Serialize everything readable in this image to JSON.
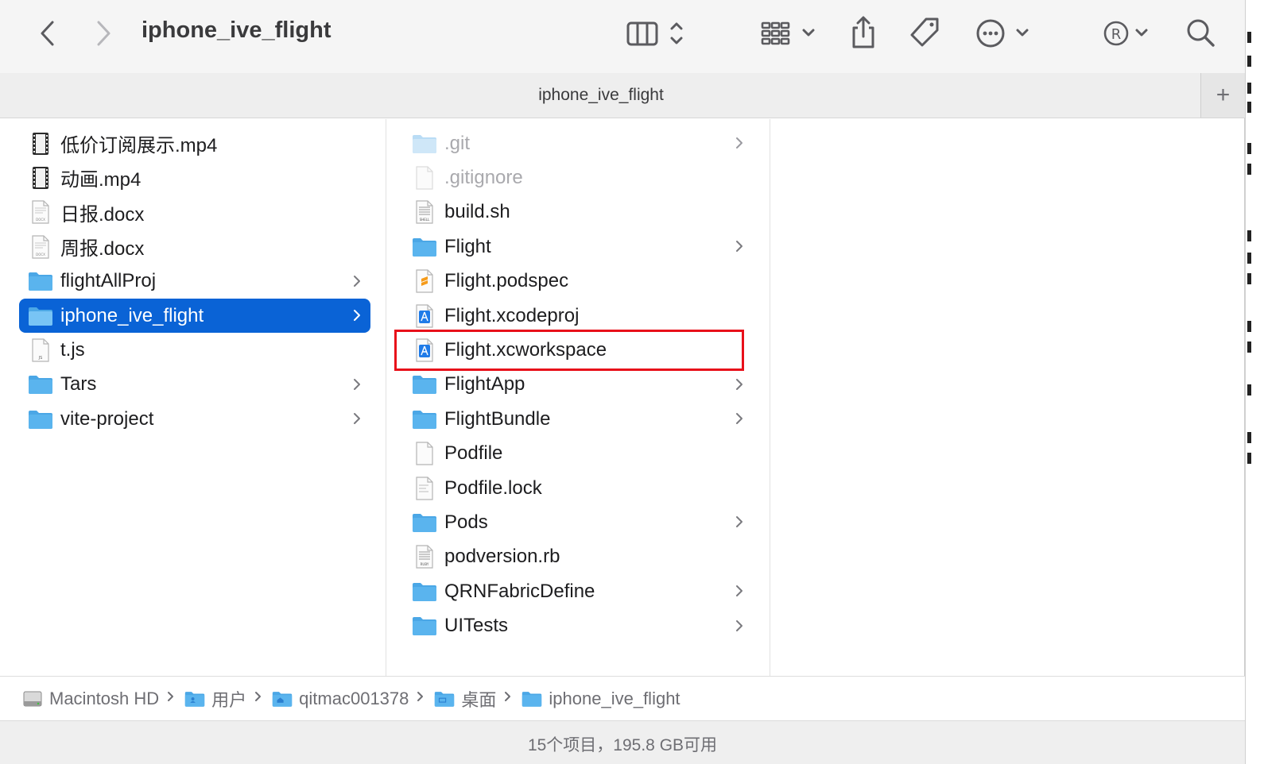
{
  "window": {
    "title": "iphone_ive_flight",
    "tab_title": "iphone_ive_flight"
  },
  "toolbar": {
    "back": "chevron-left-icon",
    "forward": "chevron-right-icon",
    "view_mode": "columns-view-icon",
    "group": "grid-group-icon",
    "share": "share-icon",
    "tag": "tag-icon",
    "more": "ellipsis-circle-icon",
    "extension": "registered-icon",
    "search": "search-icon"
  },
  "column1": {
    "items": [
      {
        "name": "低价订阅展示.mp4",
        "icon": "movie-file-icon",
        "folder": false
      },
      {
        "name": "动画.mp4",
        "icon": "movie-file-icon",
        "folder": false
      },
      {
        "name": "日报.docx",
        "icon": "docx-file-icon",
        "folder": false
      },
      {
        "name": "周报.docx",
        "icon": "docx-file-icon",
        "folder": false
      },
      {
        "name": "flightAllProj",
        "icon": "folder-icon",
        "folder": true
      },
      {
        "name": "iphone_ive_flight",
        "icon": "folder-icon",
        "folder": true,
        "selected": true
      },
      {
        "name": "t.js",
        "icon": "js-file-icon",
        "folder": false
      },
      {
        "name": "Tars",
        "icon": "folder-icon",
        "folder": true
      },
      {
        "name": "vite-project",
        "icon": "folder-icon",
        "folder": true
      }
    ]
  },
  "column2": {
    "items": [
      {
        "name": ".git",
        "icon": "folder-icon",
        "folder": true,
        "hidden": true
      },
      {
        "name": ".gitignore",
        "icon": "blank-file-icon",
        "folder": false,
        "hidden": true
      },
      {
        "name": "build.sh",
        "icon": "shell-file-icon",
        "folder": false
      },
      {
        "name": "Flight",
        "icon": "folder-icon",
        "folder": true
      },
      {
        "name": "Flight.podspec",
        "icon": "sublime-file-icon",
        "folder": false
      },
      {
        "name": "Flight.xcodeproj",
        "icon": "xcode-project-icon",
        "folder": false
      },
      {
        "name": "Flight.xcworkspace",
        "icon": "xcode-workspace-icon",
        "folder": false,
        "highlighted": true
      },
      {
        "name": "FlightApp",
        "icon": "folder-icon",
        "folder": true
      },
      {
        "name": "FlightBundle",
        "icon": "folder-icon",
        "folder": true
      },
      {
        "name": "Podfile",
        "icon": "blank-file-icon",
        "folder": false
      },
      {
        "name": "Podfile.lock",
        "icon": "text-file-icon",
        "folder": false
      },
      {
        "name": "Pods",
        "icon": "folder-icon",
        "folder": true
      },
      {
        "name": "podversion.rb",
        "icon": "ruby-file-icon",
        "folder": false
      },
      {
        "name": "QRNFabricDefine",
        "icon": "folder-icon",
        "folder": true
      },
      {
        "name": "UITests",
        "icon": "folder-icon",
        "folder": true
      }
    ]
  },
  "pathbar": {
    "crumbs": [
      {
        "label": "Macintosh HD",
        "icon": "hard-drive-icon"
      },
      {
        "label": "用户",
        "icon": "users-folder-icon"
      },
      {
        "label": "qitmac001378",
        "icon": "home-folder-icon"
      },
      {
        "label": "桌面",
        "icon": "desktop-folder-icon"
      },
      {
        "label": "iphone_ive_flight",
        "icon": "folder-icon"
      }
    ]
  },
  "status": {
    "text": "15个项目，195.8 GB可用"
  },
  "colors": {
    "selection": "#0a63d6",
    "folder": "#5ab4ee",
    "highlight_box": "#e8101a"
  }
}
